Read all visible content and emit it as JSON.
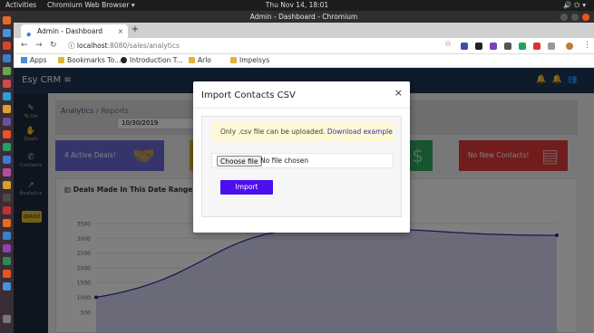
{
  "os": {
    "activities": "Activities",
    "app_name": "Chromium Web Browser",
    "clock": "Thu Nov 14, 18:01"
  },
  "window": {
    "title": "Admin - Dashboard - Chromium"
  },
  "tabs": [
    {
      "label": "Admin - Dashboard"
    }
  ],
  "address": {
    "host": "localhost",
    "path": ":8080/sales/analytics"
  },
  "bookmarks": [
    {
      "label": "Apps"
    },
    {
      "label": "Bookmarks To..."
    },
    {
      "label": "Introduction T..."
    },
    {
      "label": "Arlo"
    },
    {
      "label": "Impelsys"
    }
  ],
  "crm": {
    "logo": "Esy CRM",
    "menu_icon": "hamburger-icon",
    "sidebar": [
      {
        "label": "To Do",
        "icon": "todo-icon"
      },
      {
        "label": "Deals",
        "icon": "handshake-icon"
      },
      {
        "label": "Contacts",
        "icon": "phone-icon"
      },
      {
        "label": "Analytics",
        "icon": "chart-icon"
      }
    ],
    "add_label": "Add",
    "breadcrumb": {
      "root": "Analytics",
      "sep": " / ",
      "current": "Reports"
    },
    "date_value": "10/30/2019",
    "cards": [
      {
        "label": "4 Active Deals!",
        "color": "#6a6ad8"
      },
      {
        "label": "",
        "color": "#e6b82e"
      },
      {
        "label": "",
        "color": "#2eaa5b"
      },
      {
        "label": "No New Contacts!",
        "color": "#e23b3b"
      }
    ],
    "chart_title": "Deals Made In This Date Range"
  },
  "chart_data": {
    "type": "area",
    "title": "Deals Made In This Date Range",
    "y_ticks": [
      "3500",
      "3000",
      "2500",
      "2000",
      "1500",
      "1000",
      "500"
    ],
    "ylim": [
      500,
      3500
    ],
    "x": [
      0,
      1,
      2
    ],
    "values": [
      1000,
      3350,
      3100
    ],
    "fill": "#c9cbef",
    "line": "#2a2a9a"
  },
  "modal": {
    "title": "Import Contacts CSV",
    "alert_text": "Only .csv file can be uploaded. ",
    "alert_link": "Download example",
    "choose_file": "Choose file",
    "file_status": "No file chosen",
    "import_label": "Import"
  }
}
